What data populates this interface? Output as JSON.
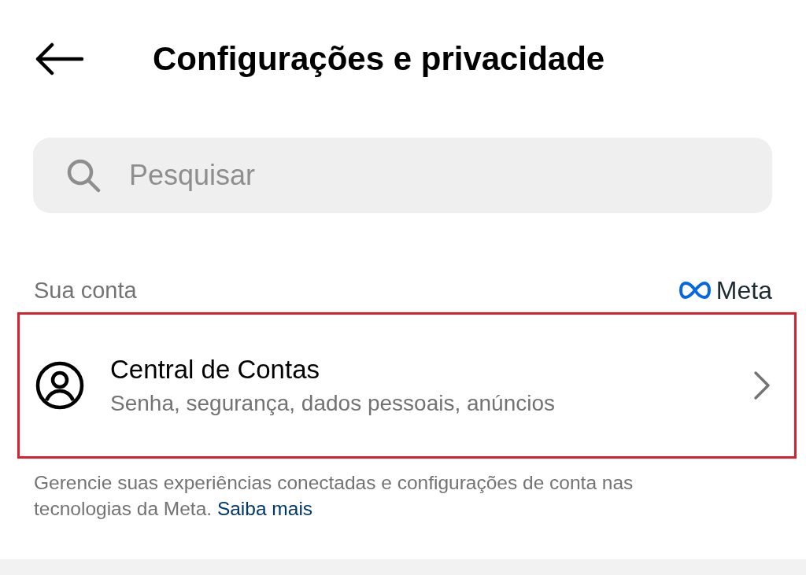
{
  "header": {
    "title": "Configurações e privacidade"
  },
  "search": {
    "placeholder": "Pesquisar"
  },
  "section": {
    "title": "Sua conta",
    "brand": "Meta"
  },
  "items": [
    {
      "title": "Central de Contas",
      "subtitle": "Senha, segurança, dados pessoais, anúncios",
      "highlighted": true
    }
  ],
  "footer": {
    "text": "Gerencie suas experiências conectadas e configurações de conta nas tecnologias da Meta.",
    "link": "Saiba mais"
  }
}
